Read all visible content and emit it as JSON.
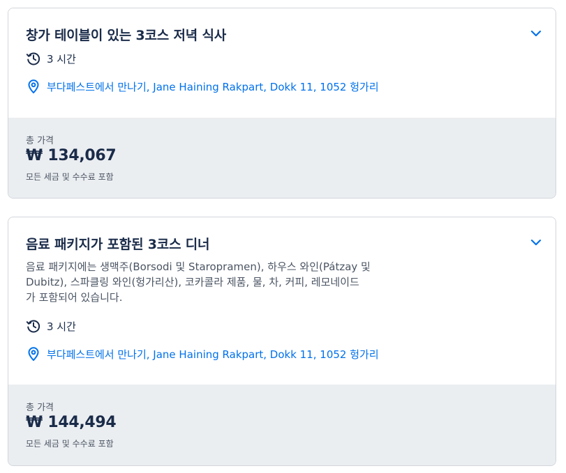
{
  "colors": {
    "link": "#0071eb",
    "text": "#1a2b49",
    "muted": "#4b5563",
    "panel": "#ebeef1",
    "border": "#d1d5db"
  },
  "icons": {
    "duration": "clock-history-icon",
    "location": "map-pin-icon",
    "expand": "chevron-down-icon"
  },
  "options": [
    {
      "title": "창가 테이블이 있는 3코스 저녁 식사",
      "description": "",
      "duration": "3 시간",
      "location": "부다페스트에서 만나기, Jane Haining Rakpart, Dokk 11, 1052 헝가리",
      "price_label": "총 가격",
      "price": "₩ 134,067",
      "price_note": "모든 세금 및 수수료 포함"
    },
    {
      "title": "음료 패키지가 포함된 3코스 디너",
      "description": [
        "음료 패키지에는 생맥주(Borsodi 및 Staropramen), 하우스 와인(Pátzay 및",
        "Dubitz), 스파클링 와인(헝가리산), 코카콜라 제품, 물, 차, 커피, 레모네이드",
        "가 포함되어 있습니다."
      ],
      "duration": "3 시간",
      "location": "부다페스트에서 만나기, Jane Haining Rakpart, Dokk 11, 1052 헝가리",
      "price_label": "총 가격",
      "price": "₩ 144,494",
      "price_note": "모든 세금 및 수수료 포함"
    }
  ]
}
